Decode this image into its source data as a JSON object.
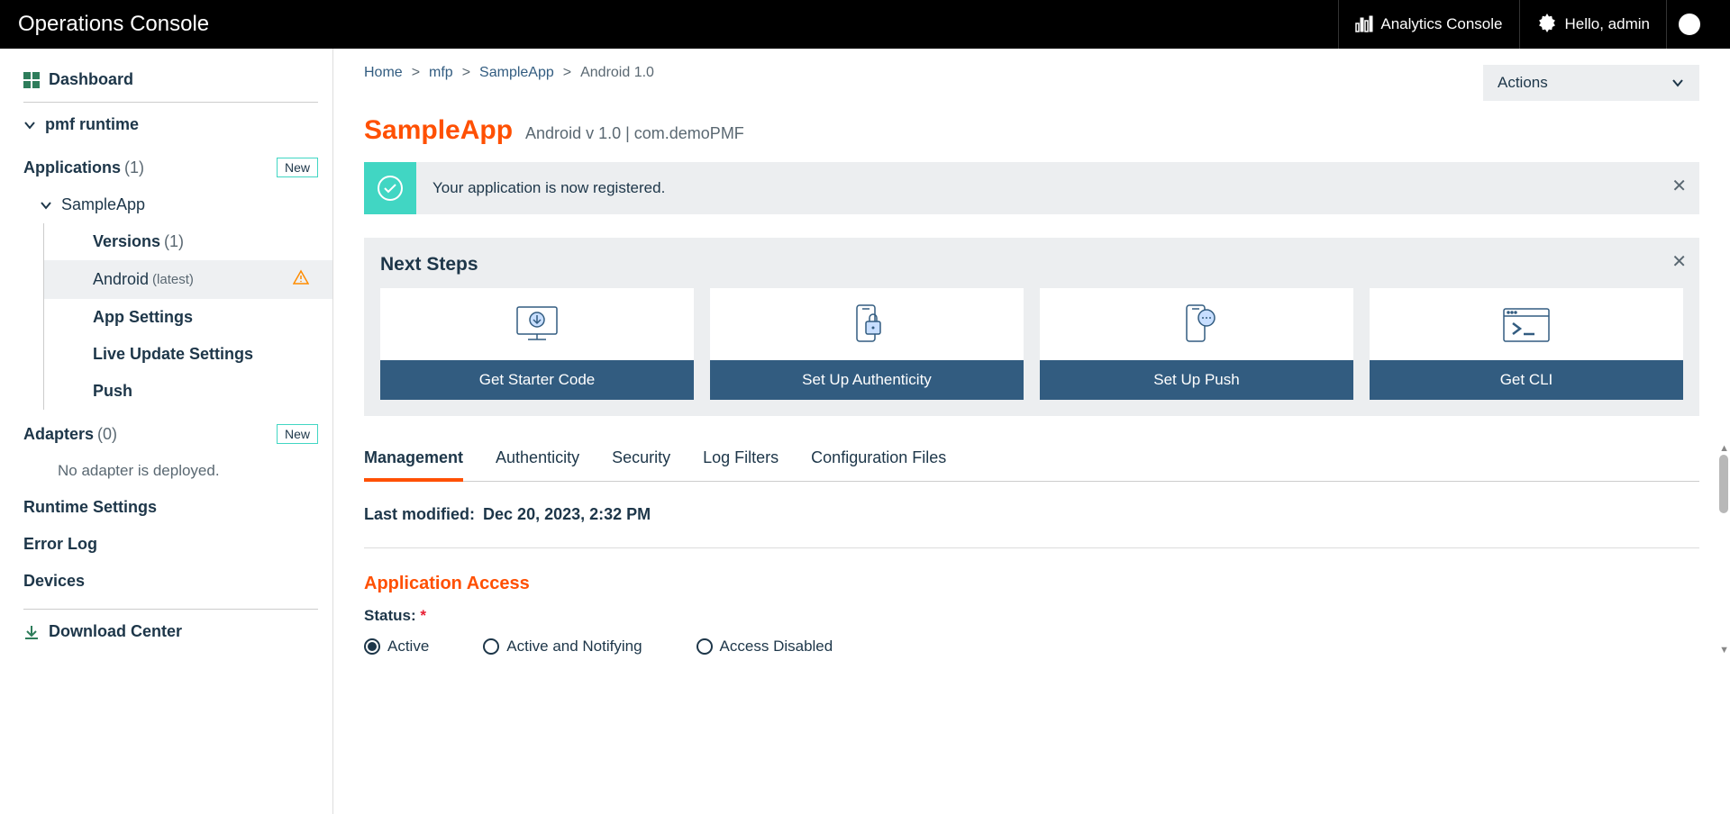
{
  "topbar": {
    "title": "Operations Console",
    "analytics": "Analytics Console",
    "user_label": "Hello, admin"
  },
  "sidebar": {
    "dashboard": "Dashboard",
    "runtime": "pmf runtime",
    "applications_label": "Applications",
    "applications_count": "(1)",
    "new_btn": "New",
    "sample_app": "SampleApp",
    "versions_label": "Versions",
    "versions_count": "(1)",
    "android_label": "Android",
    "android_latest": "(latest)",
    "app_settings": "App Settings",
    "live_update": "Live Update Settings",
    "push": "Push",
    "adapters_label": "Adapters",
    "adapters_count": "(0)",
    "no_adapter": "No adapter is deployed.",
    "runtime_settings": "Runtime Settings",
    "error_log": "Error Log",
    "devices": "Devices",
    "download_center": "Download Center"
  },
  "breadcrumb": {
    "home": "Home",
    "mfp": "mfp",
    "app": "SampleApp",
    "current": "Android 1.0"
  },
  "actions": {
    "label": "Actions"
  },
  "app": {
    "name": "SampleApp",
    "subtitle": "Android v 1.0 | com.demoPMF"
  },
  "alert": {
    "text": "Your application is now registered."
  },
  "next_steps": {
    "title": "Next Steps",
    "cards": {
      "starter": "Get Starter Code",
      "authenticity": "Set Up Authenticity",
      "push": "Set Up Push",
      "cli": "Get CLI"
    }
  },
  "tabs": {
    "management": "Management",
    "authenticity": "Authenticity",
    "security": "Security",
    "log_filters": "Log Filters",
    "config_files": "Configuration Files"
  },
  "last_modified": {
    "label": "Last modified:",
    "value": "Dec 20, 2023, 2:32 PM"
  },
  "access": {
    "title": "Application Access",
    "status_label": "Status:",
    "options": {
      "active": "Active",
      "notifying": "Active and Notifying",
      "disabled": "Access Disabled"
    }
  }
}
